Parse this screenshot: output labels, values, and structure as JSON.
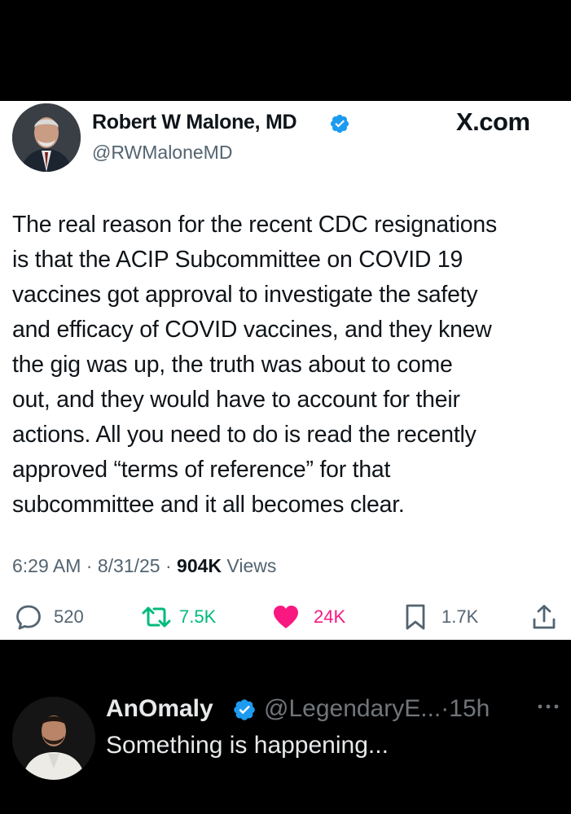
{
  "post": {
    "author_name": "Robert W Malone, MD",
    "author_handle": "@RWMaloneMD",
    "brand": "X.com",
    "text_lines": [
      "The real reason for the recent CDC resignations",
      "is that the ACIP Subcommittee on COVID 19",
      "vaccines got approval to investigate the safety",
      "and efficacy of COVID vaccines, and they knew",
      "the gig was up, the truth was about to come",
      "out, and they would have to account for their",
      "actions.  All you need to do is read the recently",
      "approved “terms of reference” for that",
      "subcommittee and it all becomes clear."
    ],
    "time": "6:29 AM",
    "date": "8/31/25",
    "separator": "·",
    "views_count": "904K",
    "views_label": "Views",
    "stats": {
      "replies": "520",
      "reposts": "7.5K",
      "likes": "24K",
      "bookmarks": "1.7K"
    }
  },
  "reply": {
    "author_name": "AnOmaly",
    "author_handle": "@LegendaryE...",
    "age": "15h",
    "text": "Something is happening..."
  },
  "icons": {
    "verified": "verified-badge-icon",
    "reply": "speech-bubble-icon",
    "repost": "repost-arrows-icon",
    "like": "heart-icon",
    "bookmark": "bookmark-icon",
    "share": "share-upload-icon",
    "more": "more-dots-icon"
  },
  "colors": {
    "verified_blue": "#1d9bf0",
    "repost_green": "#00ba7c",
    "like_pink": "#f91880",
    "secondary_gray": "#536471"
  }
}
